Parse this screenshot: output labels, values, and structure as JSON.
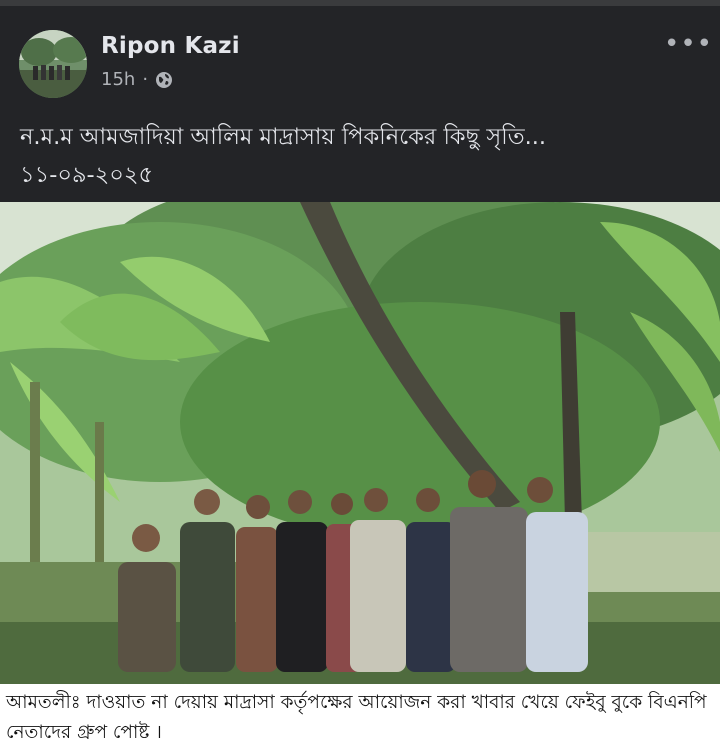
{
  "post": {
    "author": "Ripon Kazi",
    "time": "15h",
    "separator": "·",
    "privacy_icon": "globe-icon",
    "more_icon": "more-icon",
    "more_label": "•••",
    "caption_line1": "ন.ম.ম আমজাদিয়া আলিম মাদ্রাসায় পিকনিকের কিছু সৃতি...",
    "caption_line2": "১১-০৯-২০২৫"
  },
  "overlay": {
    "text": "আমতলীঃ দাওয়াত না দেয়ায় মাদ্রাসা কর্তৃপক্ষের আয়োজন করা খাবার খেয়ে ফেইবু বুকে বিএনপি নেতাদের গ্রুপ পোষ্ট ।"
  },
  "colors": {
    "background": "#232427",
    "author": "#e4e6eb",
    "meta": "#b0b3b8",
    "overlay_bg": "#ffffff"
  }
}
